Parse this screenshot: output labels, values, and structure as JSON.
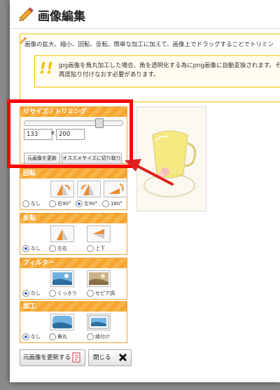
{
  "header": {
    "title": "画像編集"
  },
  "notice": {
    "text": "画像の拡大、縮小、回転、反転、簡単な加工に加えて、画像上でドラッグすることでトリミン",
    "tip_line1": "jpg画像を角丸加工した場合、角を透明化する為にpng画像に自動変換されます。そ",
    "tip_line2": "再度貼り付けなおす必要があります。"
  },
  "resize": {
    "title": "リサイズ / トリミング",
    "slider_value_fraction": 0.78,
    "width": "133",
    "times": "×",
    "height": "200",
    "reset_label": "元画像を更新",
    "recommend_label": "オススメサイズに切り取り"
  },
  "rotate": {
    "title": "回転",
    "options": [
      "なし",
      "右90°",
      "左90°",
      "180°"
    ],
    "selected": 2
  },
  "flip": {
    "title": "反転",
    "options": [
      "なし",
      "左右",
      "上下"
    ],
    "selected": 0
  },
  "filter": {
    "title": "フィルター",
    "options": [
      "なし",
      "くっきり",
      "セピア調"
    ],
    "selected": 0
  },
  "process": {
    "title": "加工",
    "options": [
      "なし",
      "角丸",
      "縁付け"
    ],
    "selected": 0
  },
  "footer": {
    "update_label": "元画像を更新する",
    "close_label": "閉じる"
  },
  "colors": {
    "accent": "#f7a52f",
    "highlight": "#ff0000",
    "notice_border": "#f2c200"
  }
}
